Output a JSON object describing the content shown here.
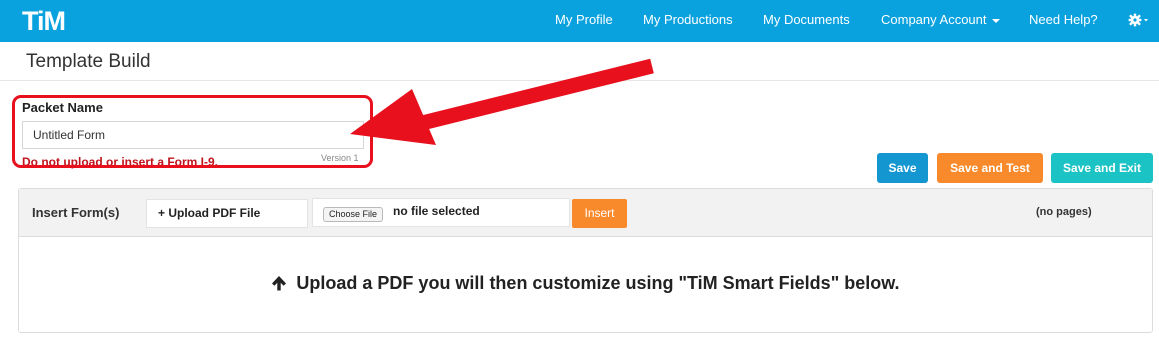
{
  "app": {
    "logo_text": "TiM",
    "brand_color": "#0aa1df"
  },
  "nav": {
    "items": [
      {
        "label": "My Profile"
      },
      {
        "label": "My Productions"
      },
      {
        "label": "My Documents"
      },
      {
        "label": "Company Account"
      },
      {
        "label": "Need Help?"
      }
    ],
    "settings_icon": "gear-icon"
  },
  "page": {
    "title": "Template Build"
  },
  "packet": {
    "label": "Packet Name",
    "value": "Untitled Form",
    "version": "Version 1",
    "warning": "Do not upload or insert a Form I-9."
  },
  "actions": {
    "save": "Save",
    "save_test": "Save and Test",
    "save_exit": "Save and Exit",
    "colors": {
      "save": "#1497d0",
      "save_test": "#f98a2b",
      "save_exit": "#1cc3c4"
    }
  },
  "insert_panel": {
    "label": "Insert Form(s)",
    "upload_button": "+ Upload PDF File",
    "choose_file": "Choose File",
    "file_status": "no file selected",
    "insert_button": "Insert",
    "pages": "(no pages)",
    "hint": "Upload a PDF you will then customize using \"TiM Smart Fields\" below."
  },
  "annotation": {
    "highlight_color": "#e8101d"
  }
}
